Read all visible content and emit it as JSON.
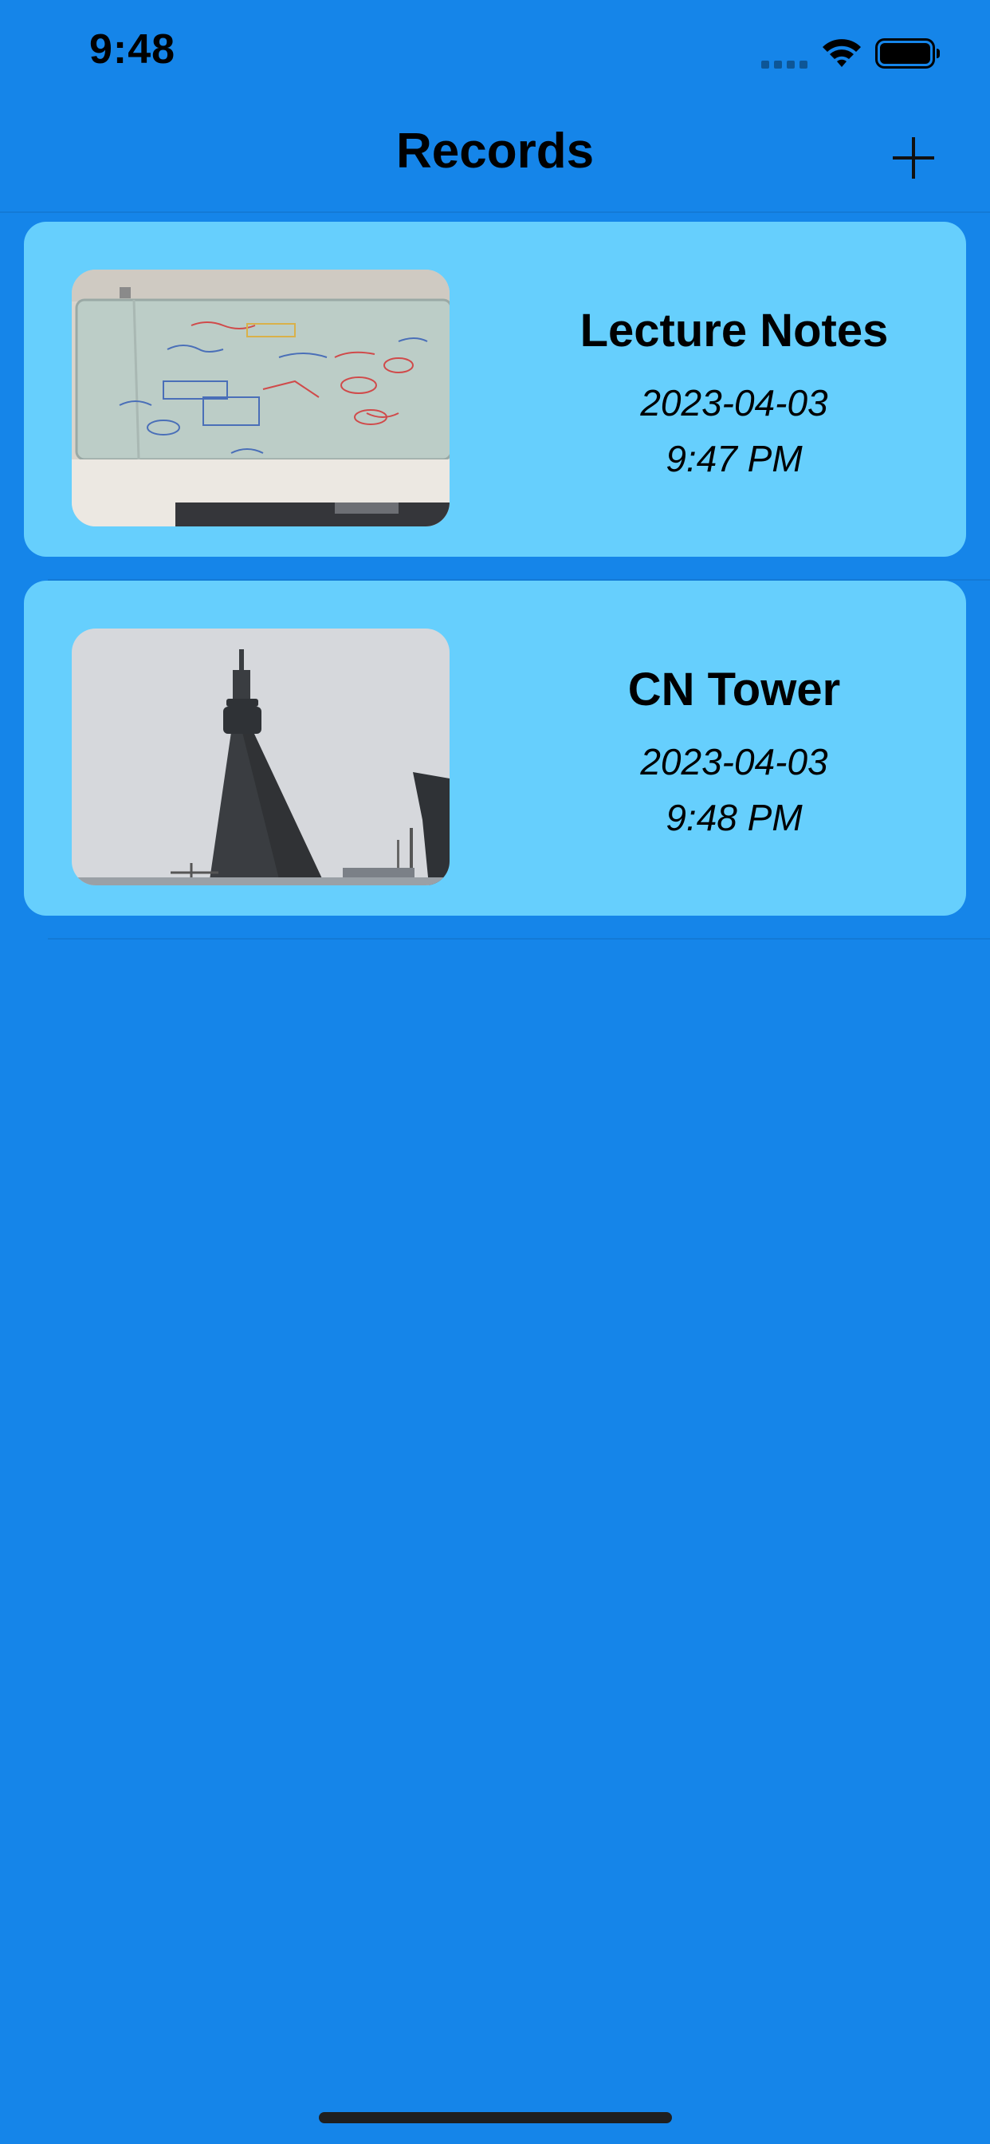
{
  "status_bar": {
    "time": "9:48"
  },
  "nav": {
    "title": "Records",
    "add_icon": "plus-icon"
  },
  "records": [
    {
      "title": "Lecture Notes",
      "date": "2023-04-03",
      "time": "9:47 PM",
      "thumbnail": "whiteboard-photo"
    },
    {
      "title": "CN Tower",
      "date": "2023-04-03",
      "time": "9:48 PM",
      "thumbnail": "cn-tower-photo"
    }
  ],
  "colors": {
    "background": "#1585e9",
    "card": "#66cffd"
  }
}
